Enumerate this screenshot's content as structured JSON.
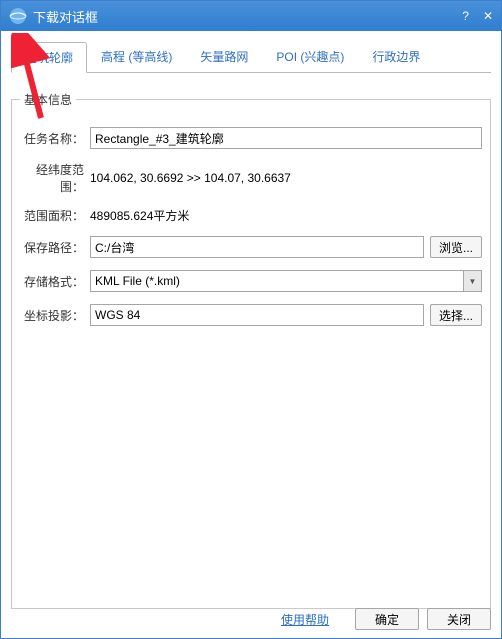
{
  "titlebar": {
    "title": "下载对话框"
  },
  "tabs": {
    "items": [
      {
        "label": "建筑轮廓"
      },
      {
        "label": "高程 (等高线)"
      },
      {
        "label": "矢量路网"
      },
      {
        "label": "POI (兴趣点)"
      },
      {
        "label": "行政边界"
      }
    ],
    "active_index": 0
  },
  "group": {
    "legend": "基本信息",
    "fields": {
      "task_name": {
        "label": "任务名称：",
        "value": "Rectangle_#3_建筑轮廓"
      },
      "extent": {
        "label": "经纬度范围：",
        "value": "104.062, 30.6692   >>   104.07, 30.6637"
      },
      "area": {
        "label": "范围面积：",
        "value": "489085.624平方米"
      },
      "save_path": {
        "label": "保存路径：",
        "value": "C:/台湾",
        "button": "浏览..."
      },
      "format": {
        "label": "存储格式：",
        "value": "KML File (*.kml)"
      },
      "projection": {
        "label": "坐标投影：",
        "value": "WGS 84",
        "button": "选择..."
      }
    }
  },
  "footer": {
    "help": "使用帮助",
    "ok": "确定",
    "close": "关闭"
  }
}
